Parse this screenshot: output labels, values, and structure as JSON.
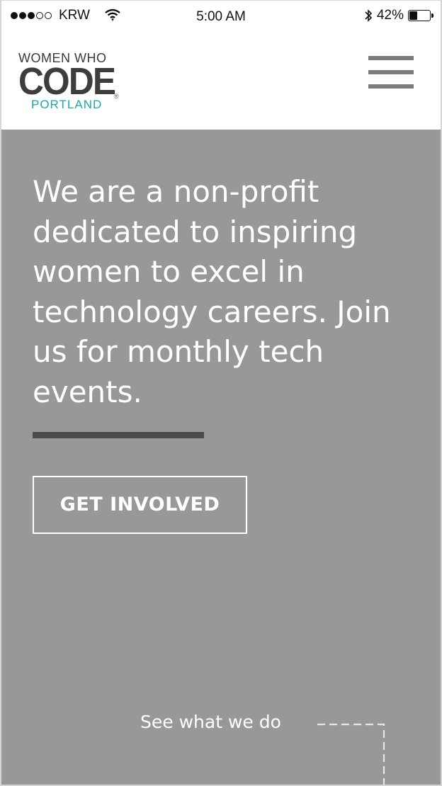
{
  "status_bar": {
    "signal_bars": 3,
    "signal_total": 5,
    "carrier": "KRW",
    "time": "5:00 AM",
    "battery": "42%",
    "battery_level": 0.42
  },
  "header": {
    "logo": {
      "line1": "WOMEN WHO",
      "line2": "CODE",
      "line3": "PORTLAND",
      "registered_mark": "®"
    },
    "menu_icon": "hamburger-menu-icon"
  },
  "hero": {
    "headline": "We are a non-profit dedicated to inspiring women to excel in technology careers. Join us for monthly tech events.",
    "cta_label": "GET INVOLVED",
    "see_what_label": "See what we do"
  },
  "colors": {
    "hero_background": "#98989b",
    "divider": "#4a4a4d",
    "logo_dark": "#3d3d3d",
    "logo_teal": "#1aa7a5",
    "menu_bars": "#7a7a7a"
  }
}
